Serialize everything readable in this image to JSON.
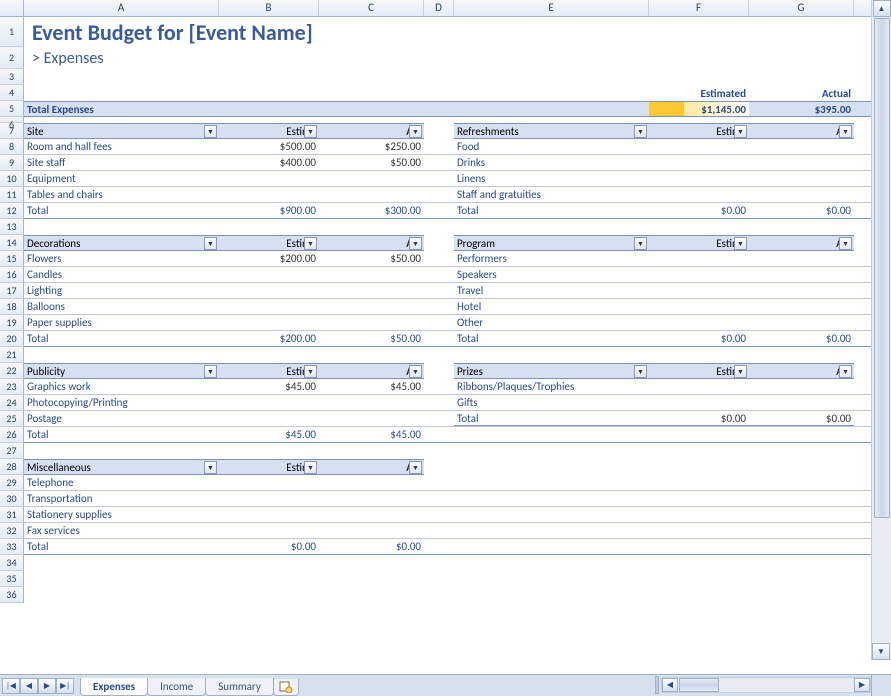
{
  "columns": [
    "A",
    "B",
    "C",
    "D",
    "E",
    "F",
    "G"
  ],
  "title": "Event Budget for [Event Name]",
  "subtitle": "> Expenses",
  "summary": {
    "est_label": "Estimated",
    "act_label": "Actual",
    "total_label": "Total Expenses",
    "est_total": "$1,145.00",
    "act_total": "$395.00"
  },
  "col_hdr": {
    "est": "Estima",
    "act": "Act"
  },
  "left": [
    {
      "name": "Site",
      "rows": [
        {
          "l": "Room and hall fees",
          "e": "$500.00",
          "a": "$250.00"
        },
        {
          "l": "Site staff",
          "e": "$400.00",
          "a": "$50.00"
        },
        {
          "l": "Equipment",
          "e": "",
          "a": ""
        },
        {
          "l": "Tables and chairs",
          "e": "",
          "a": ""
        }
      ],
      "tot_l": "Total",
      "tot_e": "$900.00",
      "tot_a": "$300.00"
    },
    {
      "name": "Decorations",
      "rows": [
        {
          "l": "Flowers",
          "e": "$200.00",
          "a": "$50.00"
        },
        {
          "l": "Candles",
          "e": "",
          "a": ""
        },
        {
          "l": "Lighting",
          "e": "",
          "a": ""
        },
        {
          "l": "Balloons",
          "e": "",
          "a": ""
        },
        {
          "l": "Paper supplies",
          "e": "",
          "a": ""
        }
      ],
      "tot_l": "Total",
      "tot_e": "$200.00",
      "tot_a": "$50.00"
    },
    {
      "name": "Publicity",
      "rows": [
        {
          "l": "Graphics work",
          "e": "$45.00",
          "a": "$45.00"
        },
        {
          "l": "Photocopying/Printing",
          "e": "",
          "a": ""
        },
        {
          "l": "Postage",
          "e": "",
          "a": ""
        }
      ],
      "tot_l": "Total",
      "tot_e": "$45.00",
      "tot_a": "$45.00"
    },
    {
      "name": "Miscellaneous",
      "rows": [
        {
          "l": "Telephone",
          "e": "",
          "a": ""
        },
        {
          "l": "Transportation",
          "e": "",
          "a": ""
        },
        {
          "l": "Stationery supplies",
          "e": "",
          "a": ""
        },
        {
          "l": "Fax services",
          "e": "",
          "a": ""
        }
      ],
      "tot_l": "Total",
      "tot_e": "$0.00",
      "tot_a": "$0.00"
    }
  ],
  "right": [
    {
      "name": "Refreshments",
      "rows": [
        {
          "l": "Food",
          "e": "",
          "a": ""
        },
        {
          "l": "Drinks",
          "e": "",
          "a": ""
        },
        {
          "l": "Linens",
          "e": "",
          "a": ""
        },
        {
          "l": "Staff and gratuities",
          "e": "",
          "a": ""
        }
      ],
      "tot_l": "Total",
      "tot_e": "$0.00",
      "tot_a": "$0.00"
    },
    {
      "name": "Program",
      "rows": [
        {
          "l": "Performers",
          "e": "",
          "a": ""
        },
        {
          "l": "Speakers",
          "e": "",
          "a": ""
        },
        {
          "l": "Travel",
          "e": "",
          "a": ""
        },
        {
          "l": "Hotel",
          "e": "",
          "a": ""
        },
        {
          "l": "Other",
          "e": "",
          "a": ""
        }
      ],
      "tot_l": "Total",
      "tot_e": "$0.00",
      "tot_a": "$0.00"
    },
    {
      "name": "Prizes",
      "rows": [
        {
          "l": "Ribbons/Plaques/Trophies",
          "e": "",
          "a": ""
        },
        {
          "l": "Gifts",
          "e": "",
          "a": ""
        }
      ],
      "tot_l": "Total",
      "tot_e": "$0.00",
      "tot_a": "$0.00"
    }
  ],
  "tabs": [
    "Expenses",
    "Income",
    "Summary"
  ],
  "active_tab": 0
}
